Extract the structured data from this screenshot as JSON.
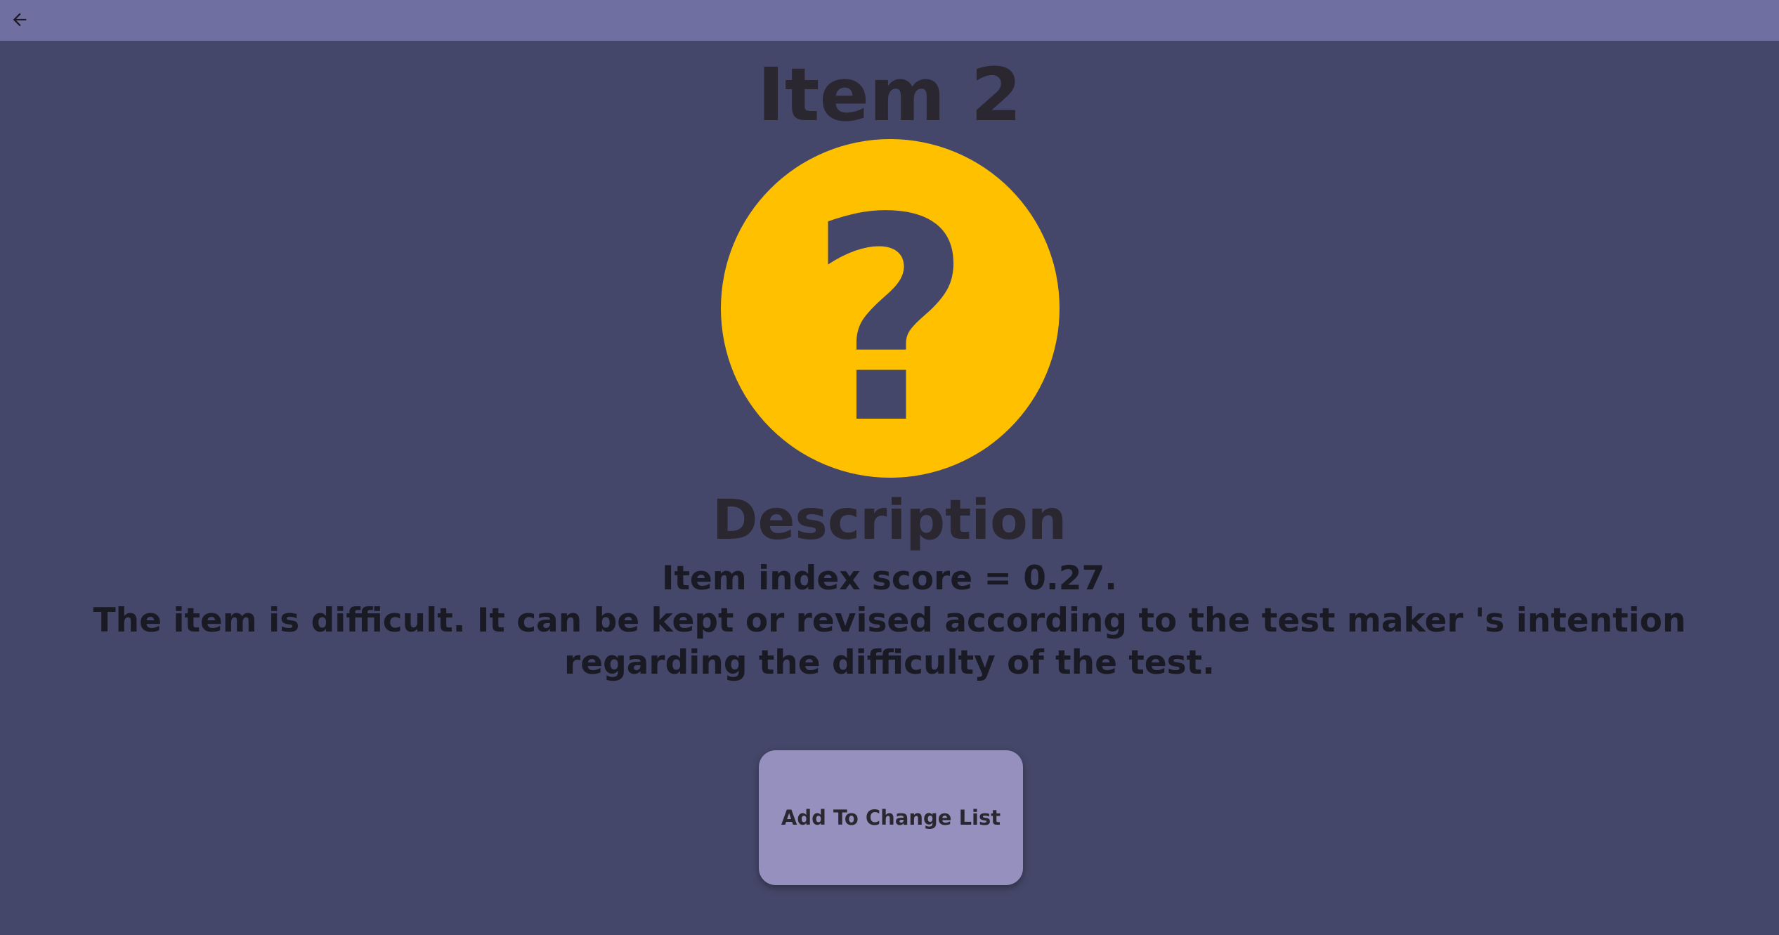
{
  "app_bar": {
    "back_icon": "arrow-left-icon",
    "color": "#6f70a1"
  },
  "page": {
    "title": "Item 2",
    "background": "#45476a"
  },
  "status_icon": {
    "name": "question-mark-icon",
    "glyph": "?",
    "color": "#ffc000"
  },
  "description": {
    "heading": "Description",
    "score_line": "Item index score = 0.27.",
    "verdict": "The item is difficult. It can be kept or revised according to the test maker 's intention regarding the difficulty of the test."
  },
  "actions": {
    "add_label": "Add To Change List",
    "button_color": "#9590bd"
  }
}
